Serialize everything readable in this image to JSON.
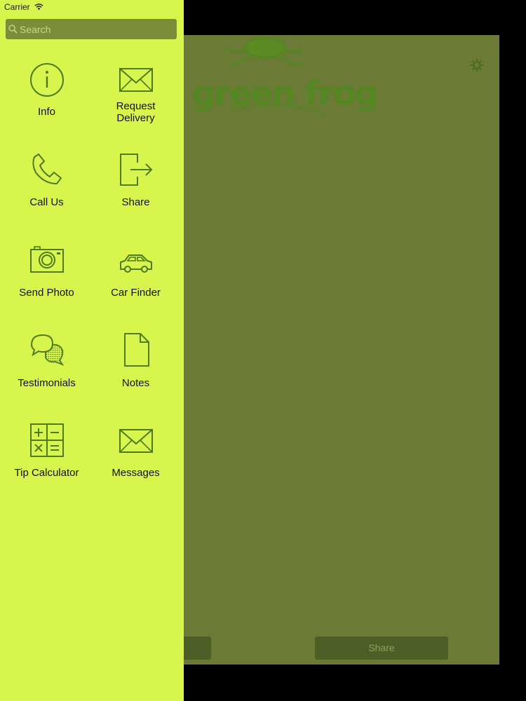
{
  "status_bar": {
    "carrier": "Carrier"
  },
  "search": {
    "placeholder": "Search"
  },
  "menu": {
    "items": [
      {
        "label": "Info",
        "icon": "info-icon"
      },
      {
        "label": "Request\nDelivery",
        "icon": "envelope-icon"
      },
      {
        "label": "Call Us",
        "icon": "phone-icon"
      },
      {
        "label": "Share",
        "icon": "share-icon"
      },
      {
        "label": "Send Photo",
        "icon": "camera-icon"
      },
      {
        "label": "Car Finder",
        "icon": "car-icon"
      },
      {
        "label": "Testimonials",
        "icon": "chat-bubbles-icon"
      },
      {
        "label": "Notes",
        "icon": "document-icon"
      },
      {
        "label": "Tip Calculator",
        "icon": "calculator-icon"
      },
      {
        "label": "Messages",
        "icon": "envelope-icon"
      }
    ]
  },
  "background": {
    "logo_text": "green frog",
    "share_button": "Share"
  },
  "colors": {
    "drawer_bg": "#d8f54d",
    "icon_stroke": "#4d7a1a",
    "panel_bg": "#6b7a35",
    "search_bg": "#7c8c39"
  }
}
